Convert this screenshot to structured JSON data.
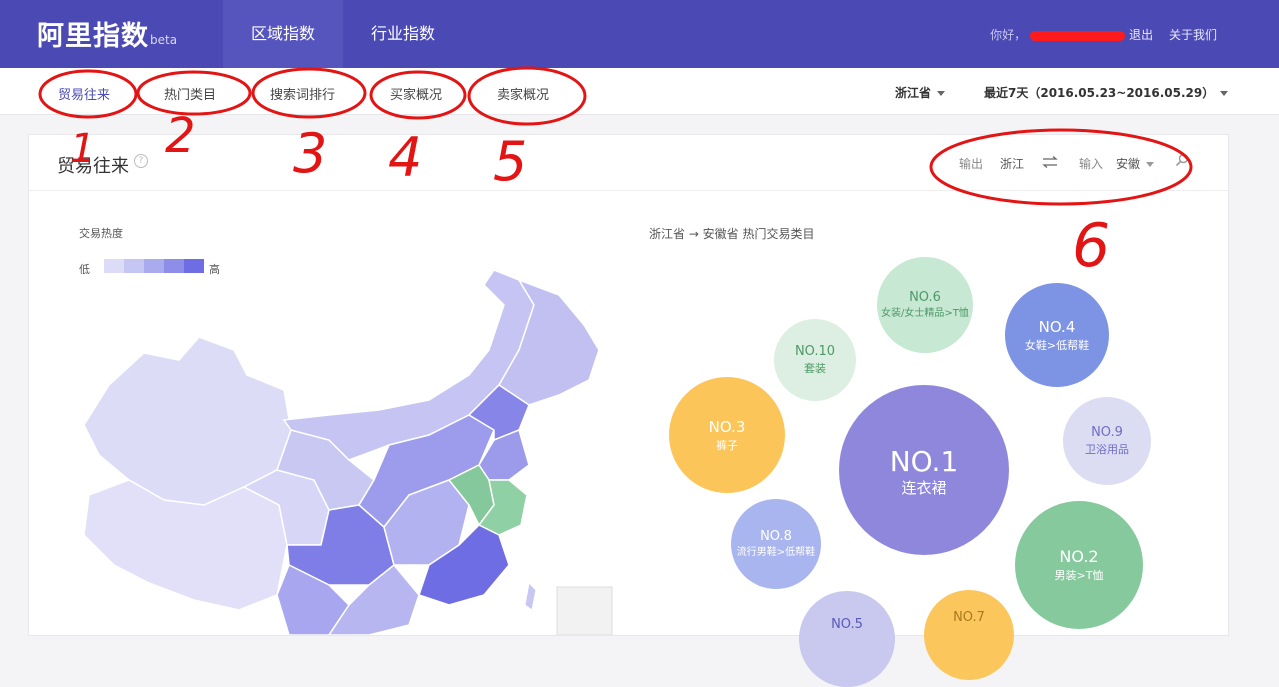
{
  "header": {
    "logo": "阿里指数",
    "logo_badge": "beta",
    "tabs": [
      {
        "label": "区域指数",
        "active": true
      },
      {
        "label": "行业指数",
        "active": false
      }
    ],
    "user": {
      "greeting": "你好，",
      "logout": "退出",
      "about": "关于我们"
    }
  },
  "subnav": {
    "tabs": [
      {
        "label": "贸易往来",
        "active": true
      },
      {
        "label": "热门类目",
        "active": false
      },
      {
        "label": "搜索词排行",
        "active": false
      },
      {
        "label": "买家概况",
        "active": false
      },
      {
        "label": "卖家概况",
        "active": false
      }
    ],
    "province": "浙江省",
    "date_range": "最近7天（2016.05.23~2016.05.29）"
  },
  "card": {
    "title": "贸易往来",
    "controls": {
      "output_label": "输出",
      "output_value": "浙江",
      "input_label": "输入",
      "input_value": "安徽"
    },
    "legend": {
      "title": "交易热度",
      "low": "低",
      "high": "高",
      "colors": [
        "#dcdcf7",
        "#c6c6f3",
        "#aaaaee",
        "#8e8ee9",
        "#6e6de3"
      ]
    },
    "flow_title": "浙江省 → 安徽省 热门交易类目",
    "bubbles": [
      {
        "rank": "NO.1",
        "category": "连衣裙",
        "color": "#8e87dc"
      },
      {
        "rank": "NO.2",
        "category": "男装>T恤",
        "color": "#85c99c"
      },
      {
        "rank": "NO.3",
        "category": "裤子",
        "color": "#fbc559"
      },
      {
        "rank": "NO.4",
        "category": "女鞋>低帮鞋",
        "color": "#7d93e4"
      },
      {
        "rank": "NO.5",
        "category": "",
        "color": "#c9c8ee"
      },
      {
        "rank": "NO.6",
        "category": "女装/女士精品>T恤",
        "color": "#c7e8d3"
      },
      {
        "rank": "NO.7",
        "category": "",
        "color": "#fbc75d"
      },
      {
        "rank": "NO.8",
        "category": "流行男鞋>低帮鞋",
        "color": "#a9b5ee"
      },
      {
        "rank": "NO.9",
        "category": "卫浴用品",
        "color": "#dcdcf3"
      },
      {
        "rank": "NO.10",
        "category": "套装",
        "color": "#dcefe2"
      }
    ]
  },
  "annotations": [
    "1",
    "2",
    "3",
    "4",
    "5",
    "6"
  ],
  "colors": {
    "brand": "#4b49b3",
    "annotation": "#e31414"
  }
}
